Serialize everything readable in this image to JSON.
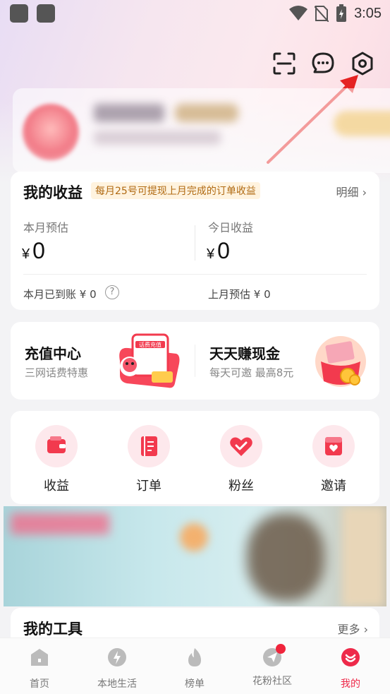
{
  "status_bar": {
    "time": "3:05"
  },
  "earnings": {
    "title": "我的收益",
    "tip": "每月25号可提现上月完成的订单收益",
    "detail_link": "明细",
    "month_est_label": "本月预估",
    "month_est_value": "0",
    "today_label": "今日收益",
    "today_value": "0",
    "currency": "¥",
    "month_received": "本月已到账 ¥ 0",
    "last_month_est": "上月预估  ¥ 0"
  },
  "promo": {
    "left": {
      "title": "充值中心",
      "sub": "三网话费特惠",
      "badge": "话费充值"
    },
    "right": {
      "title": "天天赚现金",
      "sub": "每天可邀  最高8元"
    }
  },
  "shortcuts": [
    {
      "label": "收益",
      "icon": "wallet-icon"
    },
    {
      "label": "订单",
      "icon": "order-icon"
    },
    {
      "label": "粉丝",
      "icon": "heart-icon"
    },
    {
      "label": "邀请",
      "icon": "invite-icon"
    }
  ],
  "tools": {
    "title": "我的工具",
    "more": "更多"
  },
  "tabs": [
    {
      "label": "首页",
      "icon": "home-icon"
    },
    {
      "label": "本地生活",
      "icon": "lightning-icon"
    },
    {
      "label": "榜单",
      "icon": "flame-icon"
    },
    {
      "label": "花粉社区",
      "icon": "paper-plane-icon"
    },
    {
      "label": "我的",
      "icon": "profile-icon"
    }
  ],
  "colors": {
    "accent": "#ee2a4a",
    "tip_bg": "#fff3df",
    "tip_text": "#b06a12"
  }
}
